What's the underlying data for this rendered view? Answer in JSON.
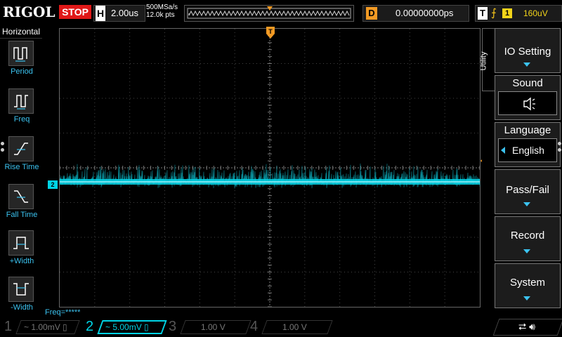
{
  "topbar": {
    "brand": "RIGOL",
    "run_state": "STOP",
    "horizontal_label": "H",
    "timebase": "2.00us",
    "sample_rate": "500MSa/s",
    "memory_depth": "12.0k pts",
    "delay_label": "D",
    "delay_value": "0.00000000ps",
    "trigger_label": "T",
    "trigger_source": "1",
    "trigger_level": "160uV"
  },
  "left_menu": {
    "title": "Horizontal",
    "items": [
      {
        "label": "Period",
        "icon": "period-icon"
      },
      {
        "label": "Freq",
        "icon": "freq-icon"
      },
      {
        "label": "Rise Time",
        "icon": "rise-time-icon"
      },
      {
        "label": "Fall Time",
        "icon": "fall-time-icon"
      },
      {
        "label": "+Width",
        "icon": "plus-width-icon"
      },
      {
        "label": "-Width",
        "icon": "minus-width-icon"
      }
    ]
  },
  "screen": {
    "freq_readout": "Freq=*****",
    "channel_marker": "2",
    "trigger_marker": "T"
  },
  "right_panel": {
    "tab": "Utility",
    "io_setting": "IO Setting",
    "sound_title": "Sound",
    "sound_icon": "speaker-icon",
    "language_title": "Language",
    "language_value": "English",
    "pass_fail": "Pass/Fail",
    "record": "Record",
    "system": "System"
  },
  "channels": [
    {
      "num": "1",
      "scale": "1.00mV",
      "active": false
    },
    {
      "num": "2",
      "scale": "5.00mV",
      "active": true
    },
    {
      "num": "3",
      "scale": "1.00 V",
      "active": false
    },
    {
      "num": "4",
      "scale": "1.00 V",
      "active": false
    }
  ],
  "colors": {
    "accent": "#3bc2ef",
    "channel2": "#00d4e6",
    "stop": "#e01818",
    "trigger": "#f29a24",
    "trigger_level": "#f2d41a"
  }
}
